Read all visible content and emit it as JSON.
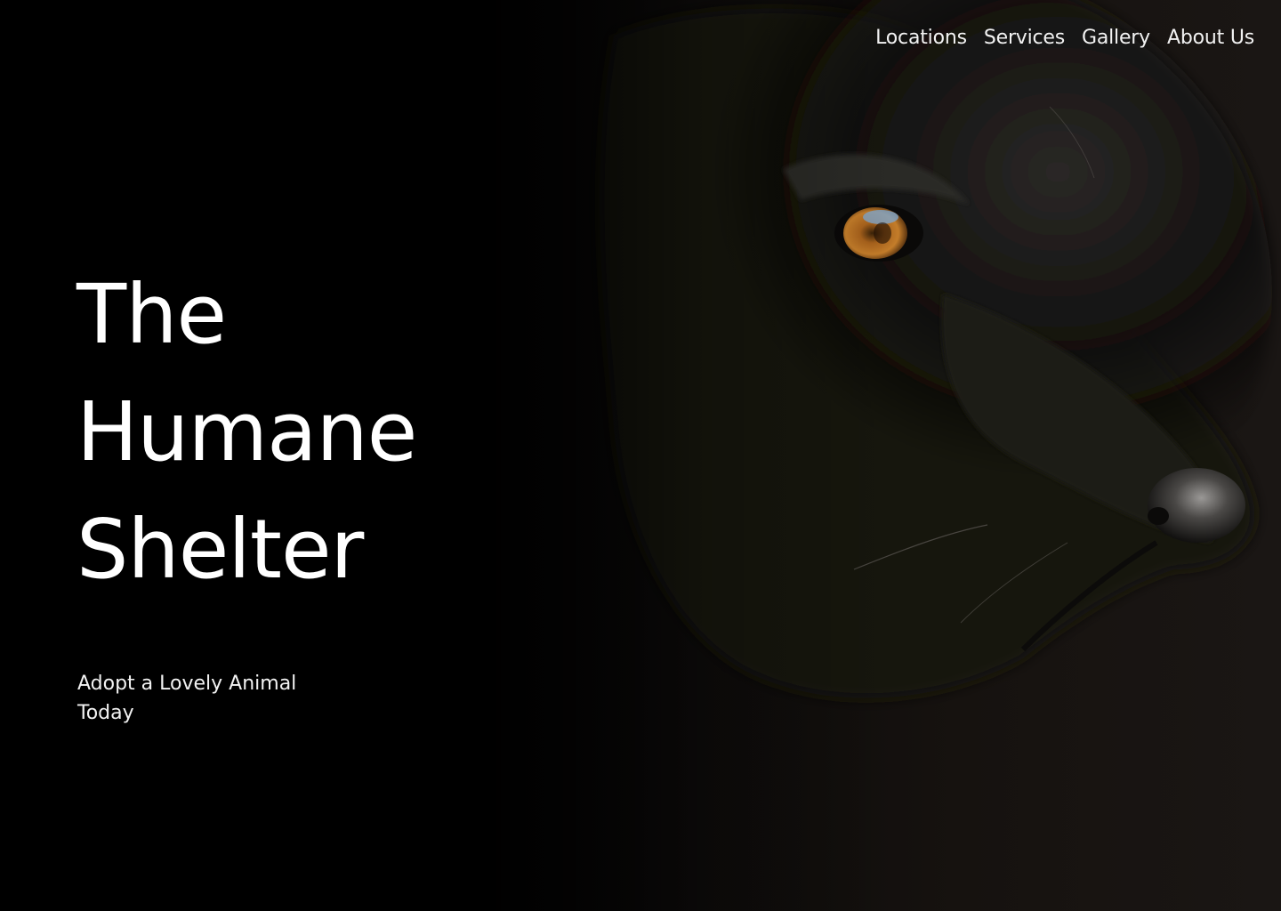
{
  "nav": {
    "items": [
      {
        "label": "Locations"
      },
      {
        "label": "Services"
      },
      {
        "label": "Gallery"
      },
      {
        "label": "About Us"
      }
    ]
  },
  "hero": {
    "title_lines": [
      "The",
      "Humane",
      "Shelter"
    ],
    "tagline": "Adopt a Lovely Animal Today",
    "image": "black-dog-portrait"
  },
  "colors": {
    "background": "#000000",
    "text": "#ffffff",
    "dog_eye": "#b5701f"
  }
}
